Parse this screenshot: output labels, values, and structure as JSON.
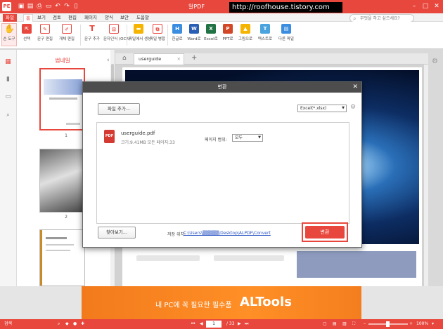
{
  "titlebar": {
    "title": "알PDF",
    "watermark": "http://roofhouse.tistory.com",
    "help_search_placeholder": "무엇을 하고 싶으세요?",
    "quick_access": [
      "save-icon",
      "print-icon",
      "undo-icon",
      "redo-icon",
      "new-doc-icon"
    ],
    "window_controls": [
      "minimize",
      "maximize",
      "close"
    ]
  },
  "menu": {
    "tabs": [
      "파일",
      "홈",
      "보기",
      "검토",
      "편집",
      "페이지",
      "양식",
      "보안",
      "도움말"
    ]
  },
  "ribbon": {
    "buttons": [
      {
        "label": "손 도구",
        "icon": "hand-icon",
        "color": "#e8473d"
      },
      {
        "label": "선택",
        "icon": "select-icon",
        "color": "#e8473d"
      },
      {
        "label": "문구 편집",
        "icon": "edit-text-icon",
        "color": "#e8473d"
      },
      {
        "label": "개체 편집",
        "icon": "edit-object-icon",
        "color": "#e8473d"
      },
      {
        "label": "문구 추가",
        "icon": "add-text-icon",
        "color": "#e8473d"
      },
      {
        "label": "문자인식 (OCR)",
        "icon": "ocr-icon",
        "color": "#e8473d"
      },
      {
        "label": "파일에서 생성",
        "icon": "folder-icon",
        "color": "#f5b400"
      },
      {
        "label": "파일 병합",
        "icon": "merge-icon",
        "color": "#e8473d"
      },
      {
        "label": "한글로",
        "icon": "hwp-icon",
        "color": "#3b8de0"
      },
      {
        "label": "Word로",
        "icon": "word-icon",
        "color": "#2b5fb4"
      },
      {
        "label": "Excel로",
        "icon": "excel-icon",
        "color": "#217346"
      },
      {
        "label": "PPT로",
        "icon": "ppt-icon",
        "color": "#d24726"
      },
      {
        "label": "그림으로",
        "icon": "image-icon",
        "color": "#f5b400"
      },
      {
        "label": "텍스트로",
        "icon": "text-icon",
        "color": "#4aa3df"
      },
      {
        "label": "다른 파일",
        "icon": "other-file-icon",
        "color": "#3b8de0"
      }
    ]
  },
  "thumbnails": {
    "title": "썸네일",
    "pages": [
      "1",
      "2"
    ]
  },
  "doctabs": {
    "active_tab": "userguide"
  },
  "modal": {
    "title": "변환",
    "add_file_label": "파일 추가...",
    "format_value": "Excel(*.xlsx)",
    "file": {
      "name": "userguide.pdf",
      "meta": "크기:9.41MB   모든 페이지:33"
    },
    "page_range_label": "페이지 범위:",
    "page_range_value": "모두",
    "browse_label": "찾아보기...",
    "save_location_label": "저장 위치:",
    "save_location_path": "C:\\Users\\▒▒▒▒▒\\Desktop\\ALPDF\\Convert",
    "convert_label": "변환"
  },
  "ad": {
    "text": "내 PC에 꼭 필요한 필수품",
    "brand": "ALTools"
  },
  "statusbar": {
    "left_label": "검색",
    "current_page": "1",
    "total_pages": "/ 33",
    "zoom": "100%"
  }
}
